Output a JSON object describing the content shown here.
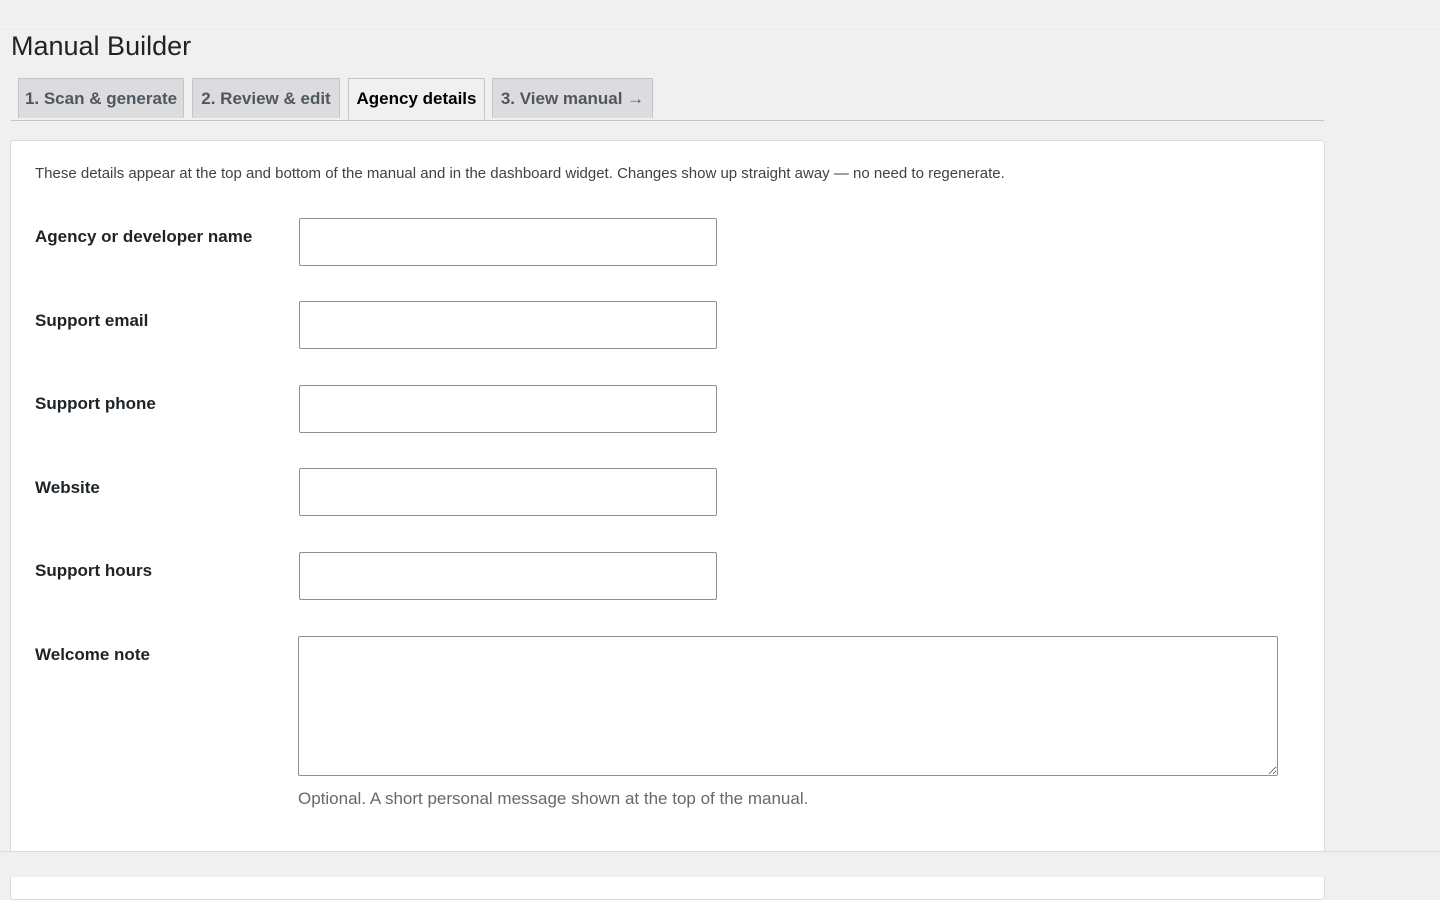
{
  "page": {
    "title": "Manual Builder"
  },
  "tabs": [
    {
      "label": "1. Scan & generate",
      "active": false
    },
    {
      "label": "2. Review & edit",
      "active": false
    },
    {
      "label": "Agency details",
      "active": true
    },
    {
      "label": "3. View manual →",
      "active": false
    }
  ],
  "form": {
    "intro": "These details appear at the top and bottom of the manual and in the dashboard widget. Changes show up straight away — no need to regenerate.",
    "fields": [
      {
        "label": "Agency or developer name",
        "value": ""
      },
      {
        "label": "Support email",
        "value": ""
      },
      {
        "label": "Support phone",
        "value": ""
      },
      {
        "label": "Website",
        "value": ""
      },
      {
        "label": "Support hours",
        "value": ""
      }
    ],
    "welcome_note": {
      "label": "Welcome note",
      "value": "",
      "help": "Optional. A short personal message shown at the top of the manual."
    }
  },
  "colors": {
    "background": "#f0f0f1",
    "card": "#ffffff",
    "tab_inactive": "#dcdcde",
    "border": "#c3c4c7",
    "text": "#1d2327",
    "muted": "#646970"
  }
}
